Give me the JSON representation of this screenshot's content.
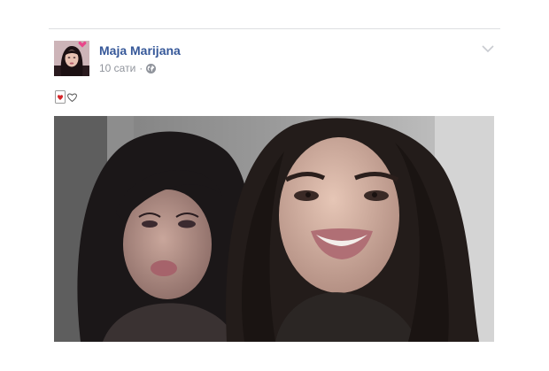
{
  "post": {
    "author": "Maja Marijana",
    "timestamp": "10 сати",
    "separator": "·",
    "privacy_icon": "globe-icon",
    "menu_icon": "chevron-down-icon",
    "text_icons": [
      "playing-card-hearts-icon",
      "white-heart-icon"
    ],
    "photo_alt": "selfie-photo"
  },
  "colors": {
    "author_link": "#365899",
    "meta_text": "#90949c",
    "divider": "#dddfe2",
    "heart_red": "#d6262a"
  }
}
